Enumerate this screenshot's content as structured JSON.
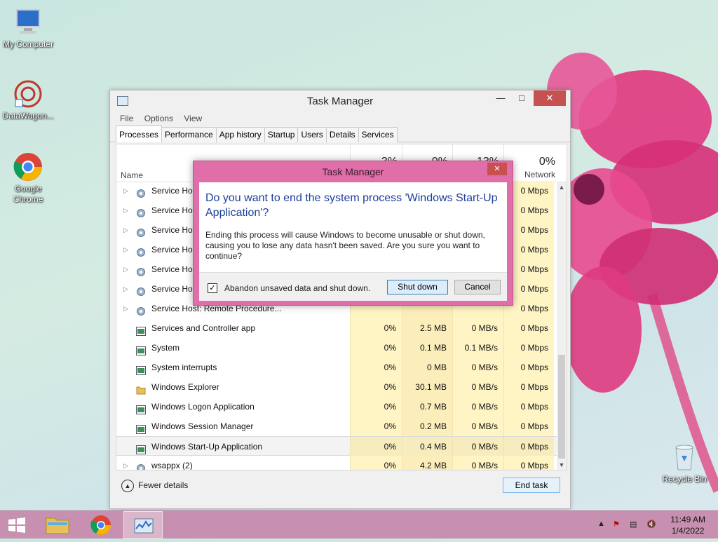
{
  "desktop": {
    "icons": [
      {
        "label": "My Computer"
      },
      {
        "label": "DataWagon..."
      },
      {
        "label": "Google Chrome"
      },
      {
        "label": "Recycle Bin"
      }
    ]
  },
  "task_manager": {
    "title": "Task Manager",
    "menu": [
      "File",
      "Options",
      "View"
    ],
    "tabs": [
      "Processes",
      "Performance",
      "App history",
      "Startup",
      "Users",
      "Details",
      "Services"
    ],
    "active_tab": "Processes",
    "header": {
      "name_label": "Name",
      "cpu_pct": "3%",
      "mem_pct": "9%",
      "disk_pct": "13%",
      "net_pct": "0%",
      "net_label": "Network"
    },
    "rows": [
      {
        "name": "Service Host",
        "expandable": true,
        "icon": "gear-icon",
        "cpu": "",
        "mem": "",
        "disk": "",
        "net": "0 Mbps"
      },
      {
        "name": "Service Host",
        "expandable": true,
        "icon": "gear-icon",
        "cpu": "",
        "mem": "",
        "disk": "",
        "net": "0 Mbps"
      },
      {
        "name": "Service Host",
        "expandable": true,
        "icon": "gear-icon",
        "cpu": "",
        "mem": "",
        "disk": "",
        "net": "0 Mbps"
      },
      {
        "name": "Service Host",
        "expandable": true,
        "icon": "gear-icon",
        "cpu": "",
        "mem": "",
        "disk": "",
        "net": "0 Mbps"
      },
      {
        "name": "Service Host",
        "expandable": true,
        "icon": "gear-icon",
        "cpu": "",
        "mem": "",
        "disk": "",
        "net": "0 Mbps"
      },
      {
        "name": "Service Host",
        "expandable": true,
        "icon": "gear-icon",
        "cpu": "",
        "mem": "",
        "disk": "",
        "net": "0 Mbps"
      },
      {
        "name": "Service Host: Remote Procedure...",
        "expandable": true,
        "icon": "gear-icon",
        "cpu": "",
        "mem": "",
        "disk": "",
        "net": "0 Mbps"
      },
      {
        "name": "Services and Controller app",
        "expandable": false,
        "icon": "app-icon",
        "cpu": "0%",
        "mem": "2.5 MB",
        "disk": "0 MB/s",
        "net": "0 Mbps"
      },
      {
        "name": "System",
        "expandable": false,
        "icon": "app-icon",
        "cpu": "0%",
        "mem": "0.1 MB",
        "disk": "0.1 MB/s",
        "net": "0 Mbps"
      },
      {
        "name": "System interrupts",
        "expandable": false,
        "icon": "app-icon",
        "cpu": "0%",
        "mem": "0 MB",
        "disk": "0 MB/s",
        "net": "0 Mbps"
      },
      {
        "name": "Windows Explorer",
        "expandable": false,
        "icon": "folder-icon",
        "cpu": "0%",
        "mem": "30.1 MB",
        "disk": "0 MB/s",
        "net": "0 Mbps"
      },
      {
        "name": "Windows Logon Application",
        "expandable": false,
        "icon": "app-icon",
        "cpu": "0%",
        "mem": "0.7 MB",
        "disk": "0 MB/s",
        "net": "0 Mbps"
      },
      {
        "name": "Windows Session Manager",
        "expandable": false,
        "icon": "app-icon",
        "cpu": "0%",
        "mem": "0.2 MB",
        "disk": "0 MB/s",
        "net": "0 Mbps"
      },
      {
        "name": "Windows Start-Up Application",
        "expandable": false,
        "icon": "app-icon",
        "cpu": "0%",
        "mem": "0.4 MB",
        "disk": "0 MB/s",
        "net": "0 Mbps",
        "selected": true
      },
      {
        "name": "wsappx (2)",
        "expandable": true,
        "icon": "gear-icon",
        "cpu": "0%",
        "mem": "4.2 MB",
        "disk": "0 MB/s",
        "net": "0 Mbps"
      }
    ],
    "fewer_details": "Fewer details",
    "end_task": "End task"
  },
  "dialog": {
    "title": "Task Manager",
    "question": "Do you want to end the system process 'Windows Start-Up Application'?",
    "message": "Ending this process will cause Windows to become unusable or shut down, causing you to lose any data hasn't been saved. Are you sure you want to continue?",
    "checkbox_label": "Abandon unsaved data and shut down.",
    "checkbox_checked": true,
    "shutdown_label": "Shut down",
    "cancel_label": "Cancel"
  },
  "taskbar": {
    "time": "11:49 AM",
    "date": "1/4/2022"
  },
  "colors": {
    "dialog_frame": "#e06ea8",
    "taskbar": "#c790b0",
    "heat_yellow": "#fff4c4"
  }
}
